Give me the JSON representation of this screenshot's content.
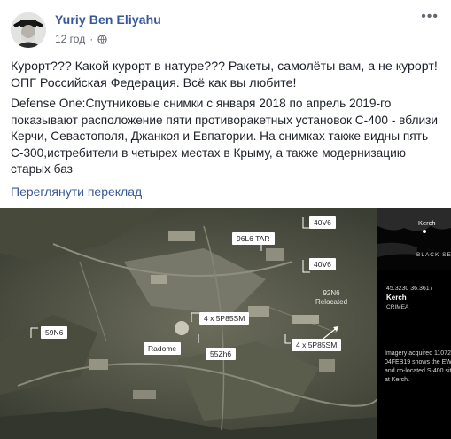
{
  "post": {
    "author": "Yuriy Ben Eliyahu",
    "time": "12 год",
    "paragraph1": "Курорт??? Какой курорт в натуре??? Ракеты, самолёты вам, а не курорт! ОПГ Российская Федерация. Всё как вы любите!",
    "paragraph2": "Defense One:Спутниковые снимки с января 2018 по апрель 2019-го показывают расположение пяти противоракетных установок С-400 - вблизи Керчи, Севастополя, Джанкоя и Евпатории. На снимках также видны пять С-300,истребители в четырех местах в Крыму, а также модернизацию старых баз",
    "translate_link": "Переглянути переклад"
  },
  "image": {
    "labels": {
      "l96l6": "96L6  TAR",
      "l40v6_top": "40V6",
      "l40v6_mid": "40V6",
      "l92n6": "92N6",
      "l92n6_sub": "Relocated",
      "l5p85sm_left": "4 x 5P85SM",
      "l5p85sm_right": "4 x 5P85SM",
      "l59n6": "59N6",
      "lradome": "Radome",
      "l55zh6": "55Zh6"
    },
    "side": {
      "city": "Kerch",
      "sea": "BLACK SEA",
      "coords": "45.3230  36.3617",
      "place": "Kerch",
      "region": "CRIMEA",
      "caption1": "Imagery acquired  11072",
      "caption2": "04FEB19 shows the EW",
      "caption3": "and co-located S-400 sit",
      "caption4": "at Kerch."
    }
  }
}
